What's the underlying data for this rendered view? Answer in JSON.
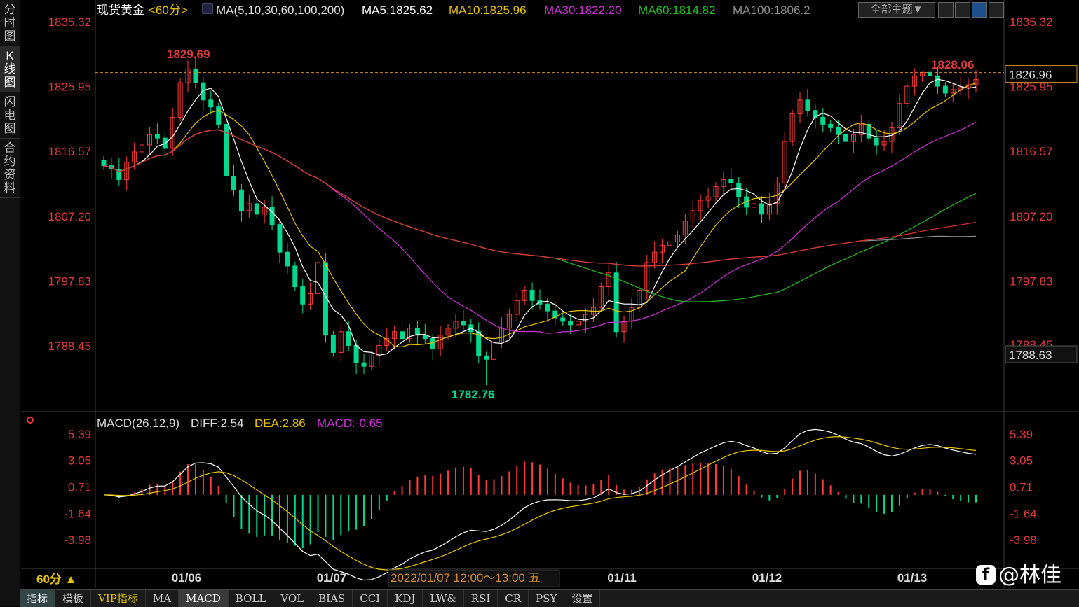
{
  "left_tabs": [
    "分时图",
    "K线图",
    "闪电图",
    "合约资料"
  ],
  "header": {
    "symbol": "现货黄金",
    "period": "<60分>",
    "ma_params": "MA(5,10,30,60,100,200)",
    "ma_values": [
      {
        "label": "MA5:1825.62",
        "color": "#ffffff"
      },
      {
        "label": "MA10:1825.96",
        "color": "#e8c400"
      },
      {
        "label": "MA30:1822.20",
        "color": "#d030d8"
      },
      {
        "label": "MA60:1814.82",
        "color": "#20c020"
      },
      {
        "label": "MA100:1806.2",
        "color": "#909090"
      }
    ],
    "theme_button": "全部主题▼"
  },
  "colors": {
    "up": "#ff3b3b",
    "down": "#00d890",
    "ma5": "#ffffff",
    "ma10": "#e8c400",
    "ma30": "#d030d8",
    "ma60": "#20c020",
    "ma100": "#909090",
    "ma200": "#e03030",
    "axis_text": "#e03a3a"
  },
  "price_panel": {
    "y_ticks": [
      "1835.32",
      "1825.95",
      "1816.57",
      "1807.20",
      "1797.83",
      "1788.45"
    ],
    "y_ticks_right_extra": "1788.45",
    "current_price_tag": "1826.96",
    "low_price_tag": "1788.63",
    "high_label": "1829.69",
    "recent_high_label": "1828.06",
    "low_label": "1782.76"
  },
  "macd_panel": {
    "title": "MACD(26,12,9)",
    "diff": "DIFF:2.54",
    "dea": "DEA:2.86",
    "macd": "MACD:-0.65",
    "y_ticks": [
      "5.39",
      "3.05",
      "0.71",
      "-1.64",
      "-3.98"
    ]
  },
  "x_axis": {
    "period_label": "60分 ▲",
    "dates": [
      "01/06",
      "01/07",
      "01/11",
      "01/12",
      "01/13"
    ],
    "cursor_label": "2022/01/07 12:00～13:00 五"
  },
  "bottom_tabs": [
    "指标",
    "模板",
    "VIP指标",
    "MA",
    "MACD",
    "BOLL",
    "VOL",
    "BIAS",
    "CCI",
    "KDJ",
    "LW&",
    "RSI",
    "CR",
    "PSY",
    "设置"
  ],
  "watermark": "@林佳",
  "chart_data": {
    "type": "candlestick",
    "title": "现货黄金 <60分>",
    "ylim": [
      1780.5,
      1837.5
    ],
    "closes": [
      1814.5,
      1814.0,
      1812.5,
      1815.0,
      1816.5,
      1817.5,
      1819.0,
      1818.5,
      1817.0,
      1821.5,
      1826.5,
      1828.5,
      1826.5,
      1824.0,
      1823.0,
      1820.5,
      1813.0,
      1811.0,
      1808.0,
      1809.0,
      1807.5,
      1808.5,
      1806.0,
      1802.0,
      1800.0,
      1797.0,
      1794.5,
      1796.0,
      1800.5,
      1790.0,
      1787.5,
      1790.5,
      1788.5,
      1786.0,
      1785.5,
      1787.0,
      1788.5,
      1789.5,
      1790.5,
      1789.5,
      1791.0,
      1790.0,
      1789.5,
      1788.0,
      1790.0,
      1791.0,
      1792.0,
      1791.5,
      1790.5,
      1787.0,
      1786.5,
      1789.0,
      1791.0,
      1793.0,
      1795.0,
      1796.5,
      1795.0,
      1794.5,
      1793.5,
      1792.5,
      1792.0,
      1791.5,
      1792.0,
      1793.0,
      1794.0,
      1797.0,
      1799.0,
      1790.5,
      1792.0,
      1794.0,
      1796.5,
      1800.5,
      1802.0,
      1803.0,
      1803.5,
      1804.5,
      1806.5,
      1808.0,
      1809.5,
      1810.0,
      1811.5,
      1812.5,
      1812.0,
      1810.0,
      1808.5,
      1809.0,
      1807.5,
      1809.0,
      1812.0,
      1818.0,
      1822.0,
      1824.0,
      1822.5,
      1821.5,
      1820.5,
      1820.0,
      1819.0,
      1818.0,
      1819.0,
      1820.5,
      1818.5,
      1817.5,
      1818.0,
      1820.0,
      1823.5,
      1826.0,
      1827.5,
      1828.0,
      1827.5,
      1826.0,
      1825.0,
      1825.5,
      1825.8,
      1826.2,
      1826.96
    ],
    "ma_series": [
      "MA5",
      "MA10",
      "MA30",
      "MA60",
      "MA100",
      "MA200"
    ],
    "macd": {
      "diff": 2.54,
      "dea": 2.86,
      "hist": -0.65,
      "ylim": [
        -5.5,
        6.5
      ]
    }
  }
}
